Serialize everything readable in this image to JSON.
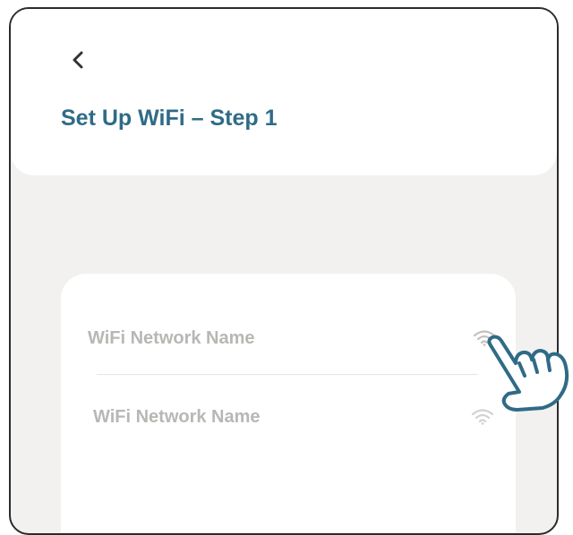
{
  "header": {
    "back_icon": "chevron-left-icon",
    "title": "Set Up WiFi – Step 1"
  },
  "networks": [
    {
      "name": "WiFi Network Name",
      "icon": "wifi-icon"
    },
    {
      "name": "WiFi Network Name",
      "icon": "wifi-icon"
    }
  ],
  "colors": {
    "title": "#2f6b87",
    "frame_background": "#f2f1ef",
    "card": "#ffffff",
    "network_text": "#b9b7b4",
    "hand_outline": "#2f6b87"
  },
  "pointer_icon": "tap-hand-icon"
}
